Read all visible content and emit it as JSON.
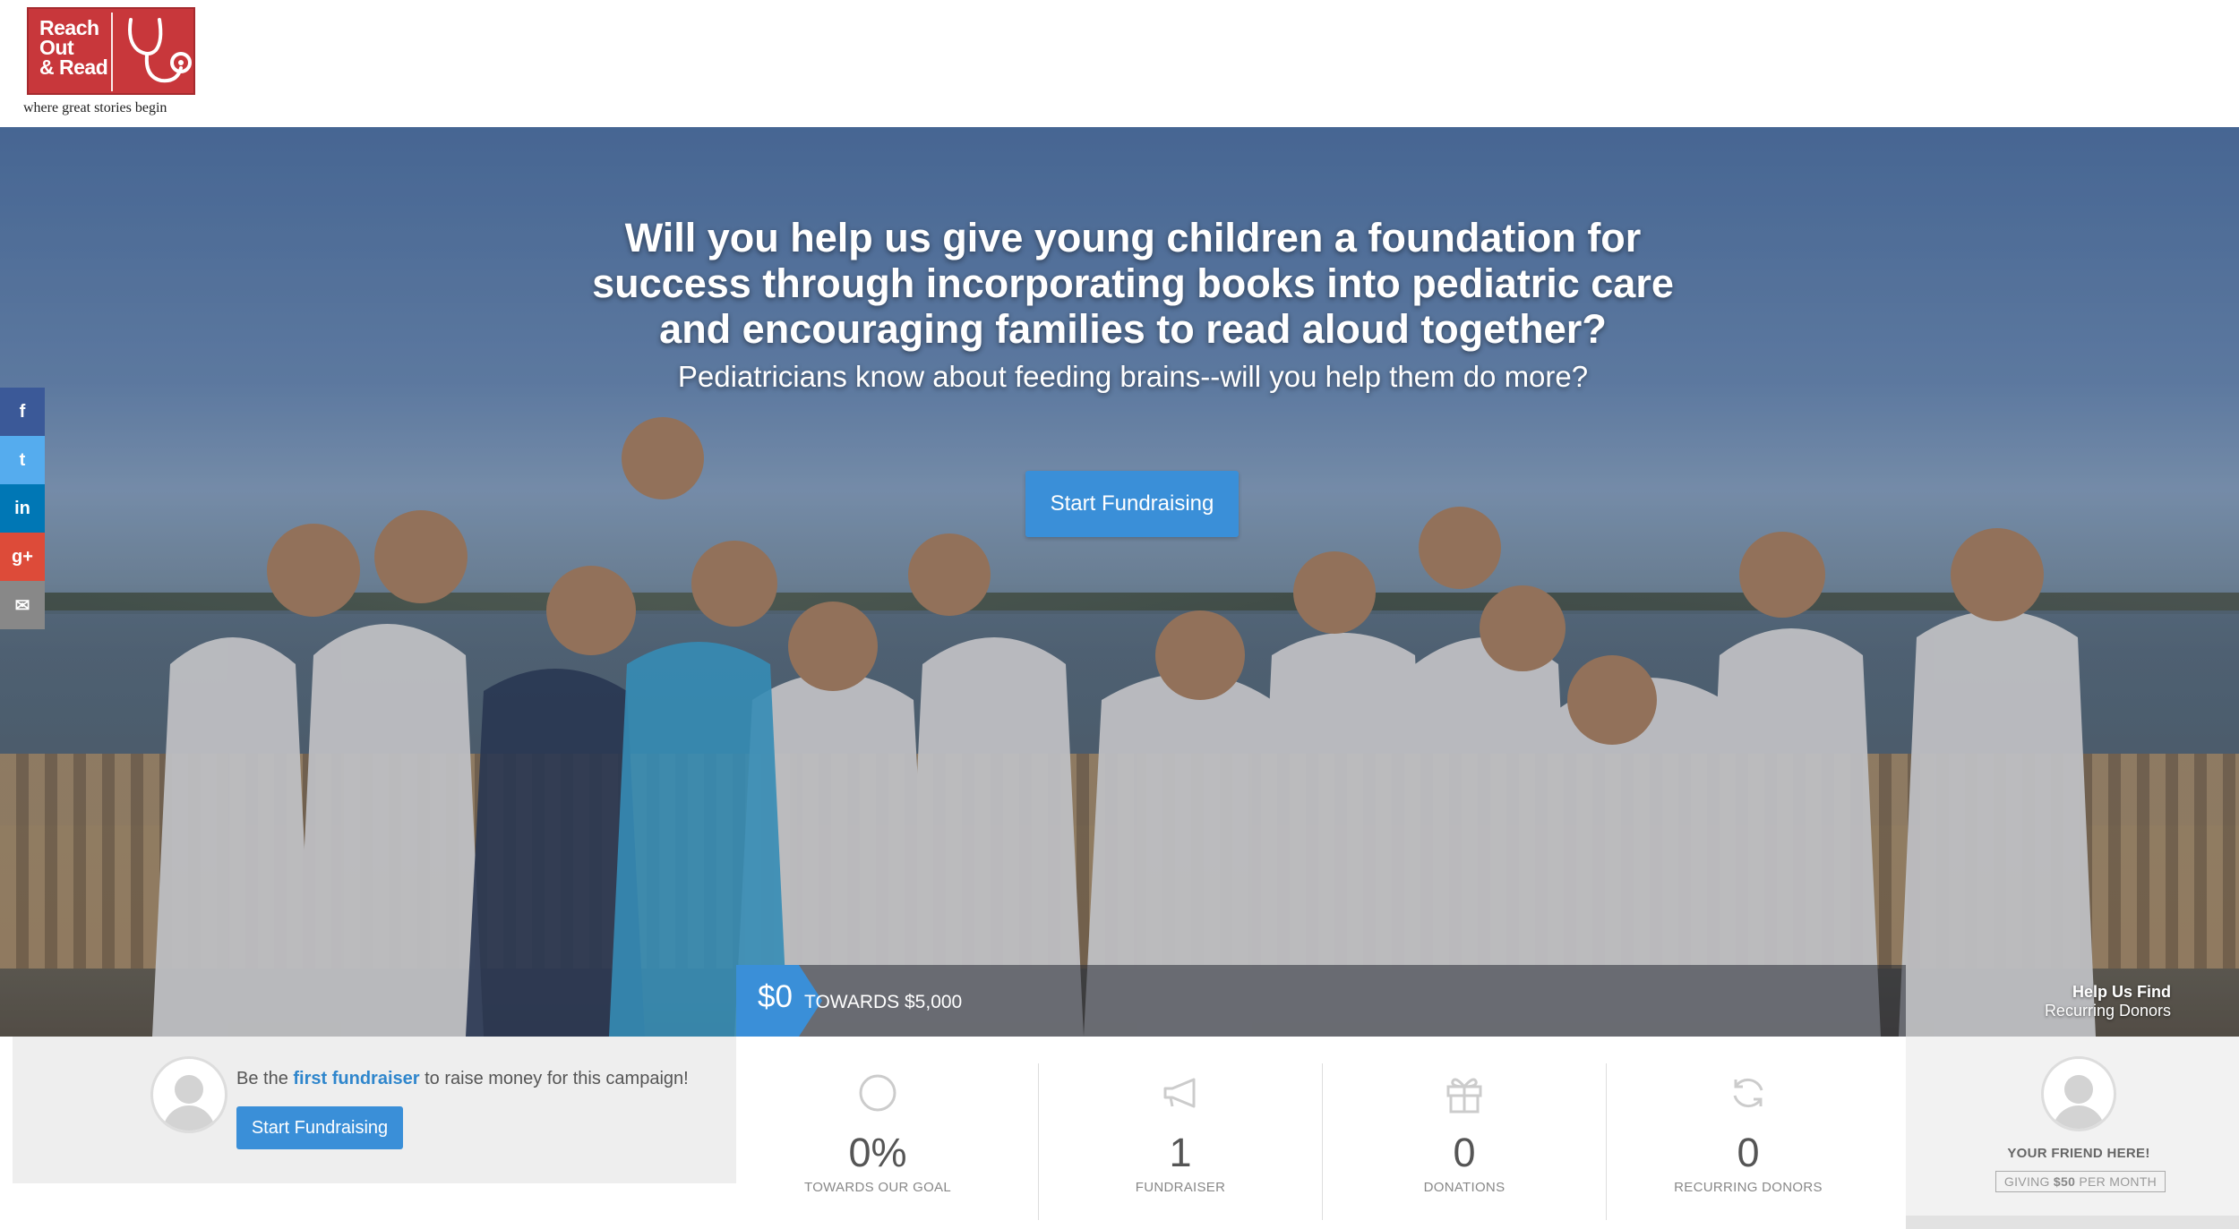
{
  "brand": {
    "logo_text": "Reach\nOut\n& Read",
    "tagline": "where great stories begin",
    "colors": {
      "logo_red": "#c8373b",
      "accent_blue": "#3a8fd8",
      "link_blue": "#2f86cc"
    }
  },
  "hero": {
    "title": "Will you help us give young children a foundation for success through incorporating books into pediatric care and encouraging families to read aloud together?",
    "subtitle": "Pediatricians know about feeding brains--will you help them do more?",
    "cta_label": "Start Fundraising"
  },
  "social": {
    "items": [
      {
        "name": "facebook",
        "glyph": "f",
        "color": "#3b5998"
      },
      {
        "name": "twitter",
        "glyph": "t",
        "color": "#55acee"
      },
      {
        "name": "linkedin",
        "glyph": "in",
        "color": "#0077b5"
      },
      {
        "name": "google-plus",
        "glyph": "g+",
        "color": "#dd4b39"
      },
      {
        "name": "email",
        "glyph": "✉",
        "color": "#888888"
      }
    ]
  },
  "progress": {
    "raised": "$0",
    "towards": "TOWARDS $5,000",
    "fraction": 0
  },
  "recurring": {
    "title": "Help Us Find",
    "subtitle": "Recurring Donors"
  },
  "fundraiser": {
    "text_prefix": "Be the ",
    "text_link": "first fundraiser",
    "text_suffix": " to raise money for this campaign!",
    "button_label": "Start Fundraising"
  },
  "stats": [
    {
      "icon": "circle-icon",
      "value": "0%",
      "label": "TOWARDS OUR GOAL"
    },
    {
      "icon": "megaphone-icon",
      "value": "1",
      "label": "FUNDRAISER"
    },
    {
      "icon": "gift-icon",
      "value": "0",
      "label": "DONATIONS"
    },
    {
      "icon": "refresh-icon",
      "value": "0",
      "label": "RECURRING DONORS"
    }
  ],
  "friend": {
    "title": "YOUR FRIEND HERE!",
    "giving_prefix": "GIVING ",
    "giving_amount": "$50",
    "giving_suffix": " PER MONTH"
  }
}
